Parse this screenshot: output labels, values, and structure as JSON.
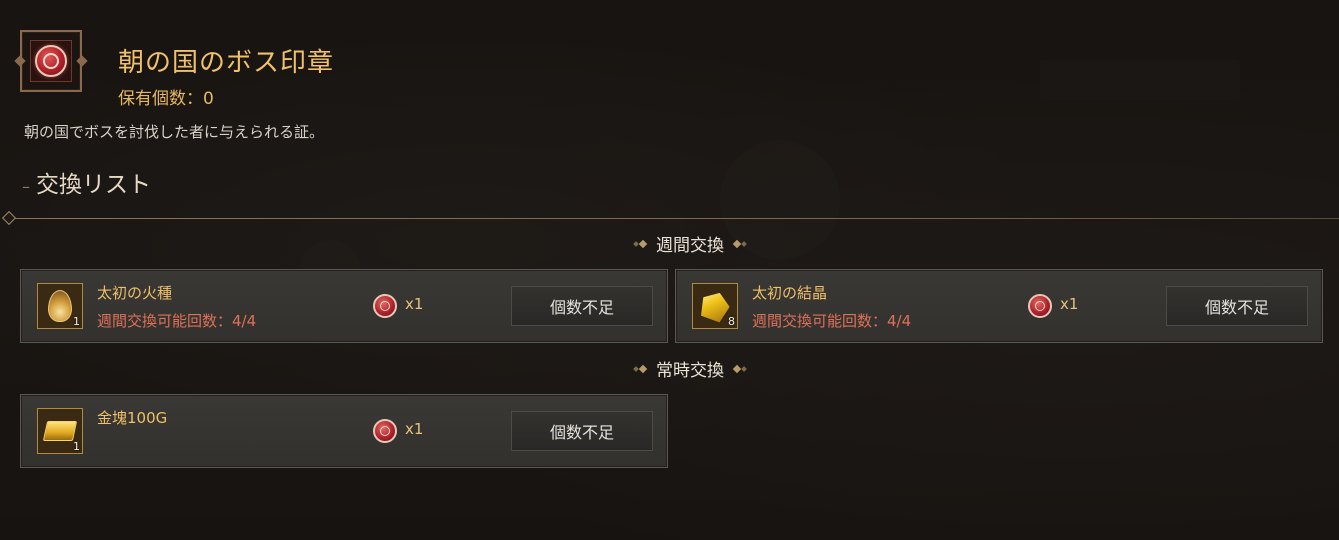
{
  "header": {
    "title": "朝の国のボス印章",
    "owned_label": "保有個数：0",
    "description": "朝の国でボスを討伐した者に与えられる証。",
    "list_title": "交換リスト",
    "emblem_icon": "boss-seal-icon"
  },
  "sections": {
    "weekly": "週間交換",
    "permanent": "常時交換"
  },
  "weekly_items": [
    {
      "name": "太初の火種",
      "limit": "週間交換可能回数：4/4",
      "icon": "flame-seed-icon",
      "count": "1",
      "cost_icon": "boss-seal-icon",
      "cost_qty": "x1",
      "button": "個数不足"
    },
    {
      "name": "太初の結晶",
      "limit": "週間交換可能回数：4/4",
      "icon": "crystal-icon",
      "count": "8",
      "cost_icon": "boss-seal-icon",
      "cost_qty": "x1",
      "button": "個数不足"
    }
  ],
  "permanent_items": [
    {
      "name": "金塊100G",
      "icon": "gold-bar-icon",
      "count": "1",
      "cost_icon": "boss-seal-icon",
      "cost_qty": "x1",
      "button": "個数不足"
    }
  ],
  "colors": {
    "title": "#f2c069",
    "limit_text": "#e07058",
    "item_name": "#f0bf67"
  }
}
